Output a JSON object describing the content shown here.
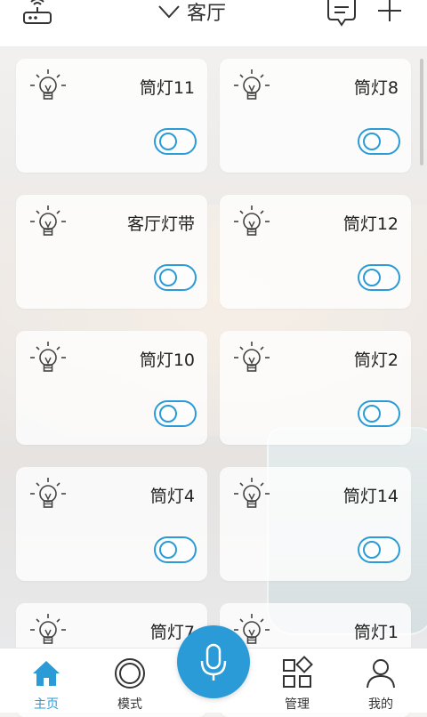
{
  "header": {
    "room_name": "客厅"
  },
  "devices": [
    {
      "name": "筒灯11"
    },
    {
      "name": "筒灯8"
    },
    {
      "name": "客厅灯带"
    },
    {
      "name": "筒灯12"
    },
    {
      "name": "筒灯10"
    },
    {
      "name": "筒灯2"
    },
    {
      "name": "筒灯4"
    },
    {
      "name": "筒灯14"
    },
    {
      "name": "筒灯7"
    },
    {
      "name": "筒灯1"
    }
  ],
  "nav": {
    "home": "主页",
    "mode": "模式",
    "manage": "管理",
    "mine": "我的"
  },
  "colors": {
    "accent": "#2a9bd6",
    "text": "#333333"
  },
  "icons": {
    "router": "router-icon",
    "chevron": "chevron-down-icon",
    "message": "message-icon",
    "add": "plus-icon",
    "bulb": "bulb-icon",
    "mic": "microphone-icon"
  }
}
